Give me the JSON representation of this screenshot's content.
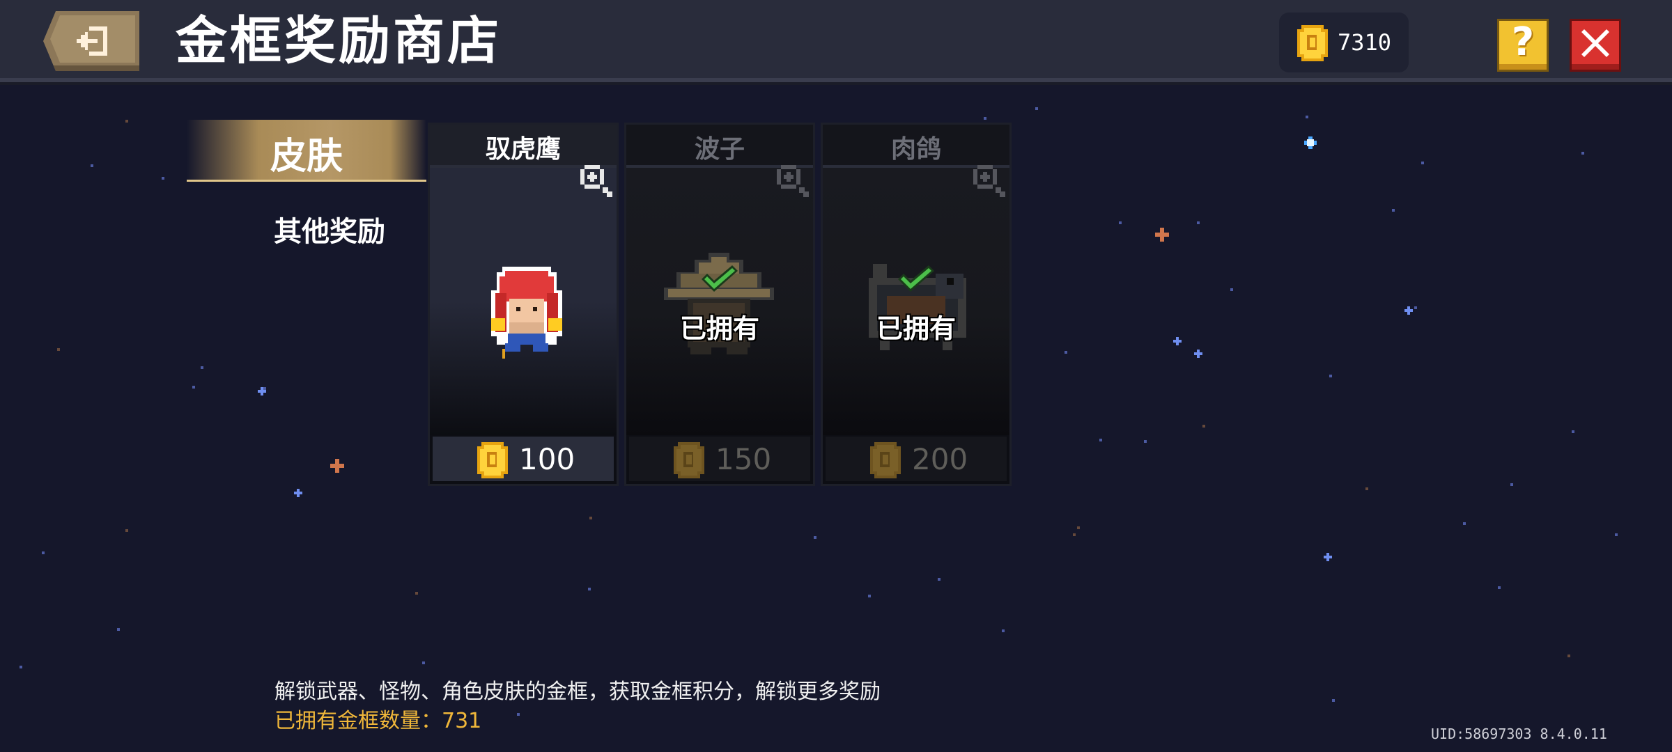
{
  "header": {
    "title": "金框奖励商店",
    "coins": "7310",
    "help_icon": "question-mark",
    "close_icon": "x-mark",
    "back_icon": "exit-door-arrow"
  },
  "sidebar": {
    "tabs": [
      {
        "label": "皮肤",
        "active": true
      },
      {
        "label": "其他奖励",
        "active": false
      }
    ]
  },
  "cards": [
    {
      "name": "驭虎鹰",
      "price": "100",
      "owned": false,
      "owned_label": ""
    },
    {
      "name": "波子",
      "price": "150",
      "owned": true,
      "owned_label": "已拥有"
    },
    {
      "name": "肉鸽",
      "price": "200",
      "owned": true,
      "owned_label": "已拥有"
    }
  ],
  "footer": {
    "description": "解锁武器、怪物、角色皮肤的金框，获取金框积分，解锁更多奖励",
    "count_line": "已拥有金框数量：731",
    "uid": "UID:58697303 8.4.0.11"
  },
  "colors": {
    "background": "#15172b",
    "gold": "#f0b73a",
    "tab_gold": "#a98b57",
    "close_red": "#d9322f",
    "help_yellow": "#f2c230",
    "check_green": "#4cbf4a"
  }
}
